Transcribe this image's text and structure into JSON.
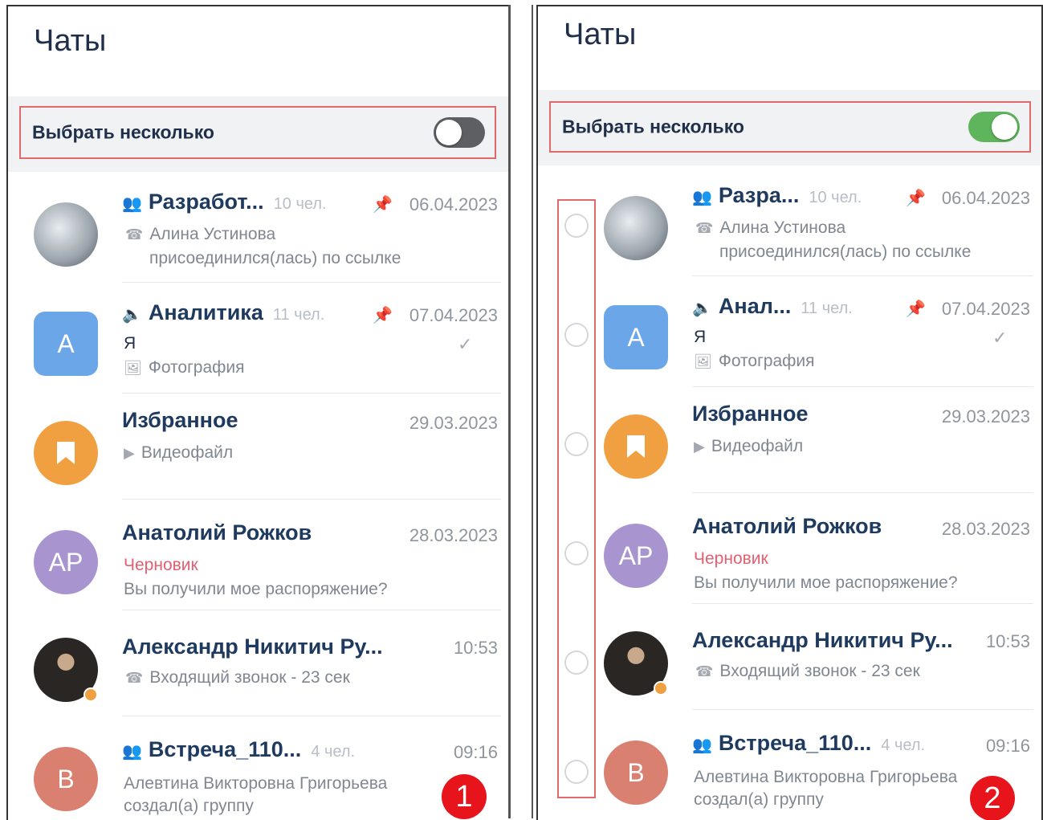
{
  "left": {
    "title": "Чаты",
    "select_label": "Выбрать несколько",
    "marker": "1",
    "chats": [
      {
        "name": "Разработ...",
        "members": "10 чел.",
        "date": "06.04.2023",
        "line1": "Алина Устинова",
        "line2": "присоединился(лась) по ссылке"
      },
      {
        "name": "Аналитика",
        "members": "11 чел.",
        "date": "07.04.2023",
        "avatar": "A",
        "line1": "Я",
        "line2": "Фотография"
      },
      {
        "name": "Избранное",
        "date": "29.03.2023",
        "line1": "Видеофайл"
      },
      {
        "name": "Анатолий Рожков",
        "date": "28.03.2023",
        "avatar": "AP",
        "line1": "Черновик",
        "line2": "Вы получили мое распоряжение?"
      },
      {
        "name": "Александр Никитич Ру...",
        "date": "10:53",
        "line1": "Входящий звонок - 23 сек"
      },
      {
        "name": "Встреча_110...",
        "members": "4 чел.",
        "date": "09:16",
        "avatar": "B",
        "line1": "Алевтина Викторовна Григорьева",
        "line2": "создал(а) группу"
      }
    ]
  },
  "right": {
    "title": "Чаты",
    "select_label": "Выбрать несколько",
    "marker": "2",
    "chats": [
      {
        "name": "Разра...",
        "members": "10 чел.",
        "date": "06.04.2023",
        "line1": "Алина Устинова",
        "line2": "присоединился(лась) по ссылке"
      },
      {
        "name": "Анал...",
        "members": "11 чел.",
        "date": "07.04.2023",
        "avatar": "A",
        "line1": "Я",
        "line2": "Фотография"
      },
      {
        "name": "Избранное",
        "date": "29.03.2023",
        "line1": "Видеофайл"
      },
      {
        "name": "Анатолий Рожков",
        "date": "28.03.2023",
        "avatar": "AP",
        "line1": "Черновик",
        "line2": "Вы получили мое распоряжение?"
      },
      {
        "name": "Александр Никитич Ру...",
        "date": "10:53",
        "line1": "Входящий звонок - 23 сек"
      },
      {
        "name": "Встреча_110...",
        "members": "4 чел.",
        "date": "09:16",
        "avatar": "B",
        "line1": "Алевтина Викторовна Григорьева",
        "line2": "создал(а) группу"
      }
    ]
  },
  "icons": {
    "group": "group-icon",
    "channel": "megaphone-icon",
    "pin": "pin-icon",
    "call": "phone-icon",
    "photo": "photo-icon",
    "video": "video-icon",
    "bookmark": "bookmark-icon",
    "read": "checkmark-icon"
  },
  "colors": {
    "avatar_blue": "#6aa6e8",
    "avatar_orange": "#f0a040",
    "avatar_purple": "#a894cf",
    "avatar_red": "#d98070",
    "toggle_on": "#5fb55c",
    "toggle_off": "#5d5f63",
    "draft": "#e26070",
    "highlight_border": "#e0696b",
    "marker": "#e8141b"
  }
}
